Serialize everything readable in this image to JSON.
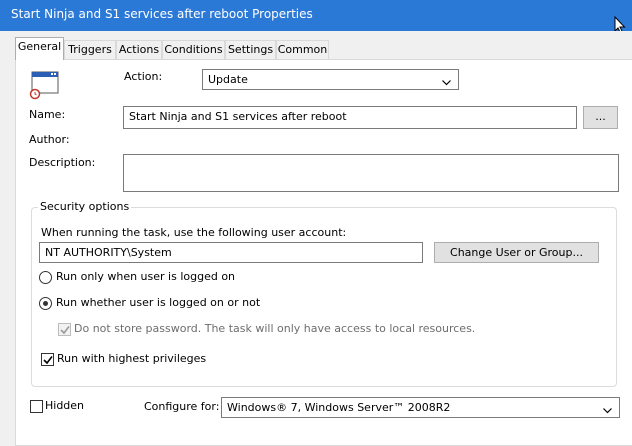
{
  "window": {
    "title": "Start Ninja and S1 services after reboot Properties"
  },
  "tabs": [
    "General",
    "Triggers",
    "Actions",
    "Conditions",
    "Settings",
    "Common"
  ],
  "general": {
    "action_label": "Action:",
    "action_value": "Update",
    "name_label": "Name:",
    "name_value": "Start Ninja and S1 services after reboot",
    "browse_button": "...",
    "author_label": "Author:",
    "description_label": "Description:",
    "description_value": ""
  },
  "security": {
    "legend": "Security options",
    "account_prompt": "When running the task, use the following user account:",
    "account_value": "NT AUTHORITY\\System",
    "change_button": "Change User or Group...",
    "radio_logged_on": "Run only when user is logged on",
    "radio_whether": "Run whether user is logged on or not",
    "no_store_password": "Do not store password. The task will only have access to local resources.",
    "highest_privileges": "Run with highest privileges",
    "run_mode": "whether",
    "no_store_checked": true,
    "no_store_enabled": false,
    "highest_checked": true
  },
  "bottom": {
    "hidden_label": "Hidden",
    "hidden_checked": false,
    "configure_label": "Configure for:",
    "configure_value": "Windows® 7, Windows Server™ 2008R2"
  },
  "colors": {
    "titlebar": "#2b79d7",
    "panel": "#ffffff",
    "dialog": "#f0f0f0"
  },
  "icons": [
    "task-icon",
    "chevron-down-icon",
    "cursor-icon",
    "checkmark-icon"
  ]
}
